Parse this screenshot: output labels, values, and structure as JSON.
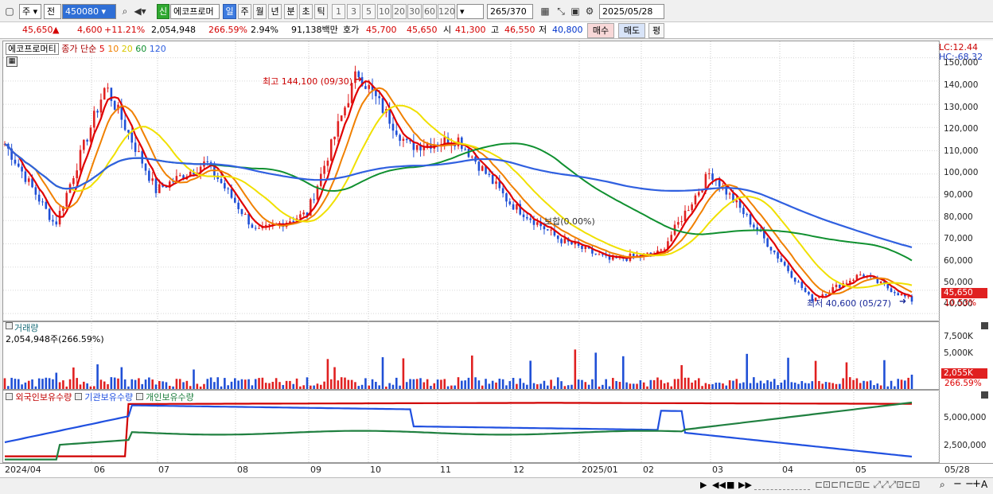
{
  "toolbar": {
    "mode": "주",
    "mode2": "전",
    "code": "450080",
    "new_badge": "신",
    "name": "에코프로머",
    "periods": [
      "일",
      "주",
      "월",
      "년",
      "분",
      "초",
      "틱"
    ],
    "nums": [
      "1",
      "3",
      "5",
      "10",
      "20",
      "30",
      "60",
      "120"
    ],
    "count": "265",
    "count_total": "/370",
    "date": "2025/05/28"
  },
  "quote": {
    "price": "45,650",
    "change": "4,600",
    "change_pct": "+11.21%",
    "volume": "2,054,948",
    "vol_ratio": "266.59%",
    "turnover": "2.94%",
    "amount": "91,138백만",
    "ask_label": "호가",
    "ask": "45,700",
    "bid": "45,650",
    "open_label": "시",
    "open": "41,300",
    "high_label": "고",
    "high": "46,550",
    "low_label": "저",
    "low": "40,800",
    "buy": "매수",
    "sell": "매도",
    "avg": "평"
  },
  "price_panel": {
    "stock_label": "에코프로머티",
    "ma_label": "종가 단순",
    "ma_periods": [
      "5",
      "10",
      "20",
      "60",
      "120"
    ],
    "ma_colors": [
      "#e00000",
      "#f08000",
      "#f0e000",
      "#109030",
      "#3060e0"
    ],
    "lc": "LC:12.44",
    "hc": "HC:-68.32",
    "high_note": "최고 144,100 (09/30)",
    "low_note": "최저 40,600 (05/27)",
    "flat_note": "보합(0.00%)",
    "price_flag": "45,650",
    "pct_flag": "10.53%",
    "yticks": [
      "150,000",
      "140,000",
      "130,000",
      "120,000",
      "110,000",
      "100,000",
      "90,000",
      "80,000",
      "70,000",
      "60,000",
      "50,000",
      "40,000"
    ]
  },
  "volume_panel": {
    "title": "거래량",
    "value": "2,054,948주(266.59%)",
    "yticks": [
      "7,500K",
      "5,000K",
      "2,500K"
    ],
    "flag": "2,055K",
    "pct": "266.59%"
  },
  "holdings_panel": {
    "legend": [
      "외국인보유수량",
      "기관보유수량",
      "개인보유수량"
    ],
    "colors": [
      "#d00000",
      "#2050e0",
      "#208040"
    ],
    "yticks": [
      "5,000,000",
      "2,500,000"
    ]
  },
  "x_axis": [
    "2024/04",
    "06",
    "07",
    "08",
    "09",
    "10",
    "11",
    "12",
    "2025/01",
    "02",
    "03",
    "04",
    "05",
    "05/28"
  ],
  "chart_data": {
    "type": "candlestick",
    "period": "daily",
    "ylim": [
      38000,
      155000
    ],
    "ohlc_points": [
      {
        "date": "2024/04",
        "close": 113000
      },
      {
        "date": "06",
        "close": 78000
      },
      {
        "date": "06",
        "close": 138000
      },
      {
        "date": "07",
        "close": 93000
      },
      {
        "date": "07",
        "close": 105000
      },
      {
        "date": "08",
        "close": 75000
      },
      {
        "date": "09",
        "close": 83000
      },
      {
        "date": "10",
        "close": 144100
      },
      {
        "date": "10",
        "close": 112000
      },
      {
        "date": "11",
        "close": 115000
      },
      {
        "date": "12",
        "close": 88000
      },
      {
        "date": "12",
        "close": 72000
      },
      {
        "date": "2025/01",
        "close": 63000
      },
      {
        "date": "02",
        "close": 66000
      },
      {
        "date": "02",
        "close": 101000
      },
      {
        "date": "03",
        "close": 74000
      },
      {
        "date": "04",
        "close": 46000
      },
      {
        "date": "05",
        "close": 57000
      },
      {
        "date": "05/28",
        "close": 45650
      }
    ]
  }
}
